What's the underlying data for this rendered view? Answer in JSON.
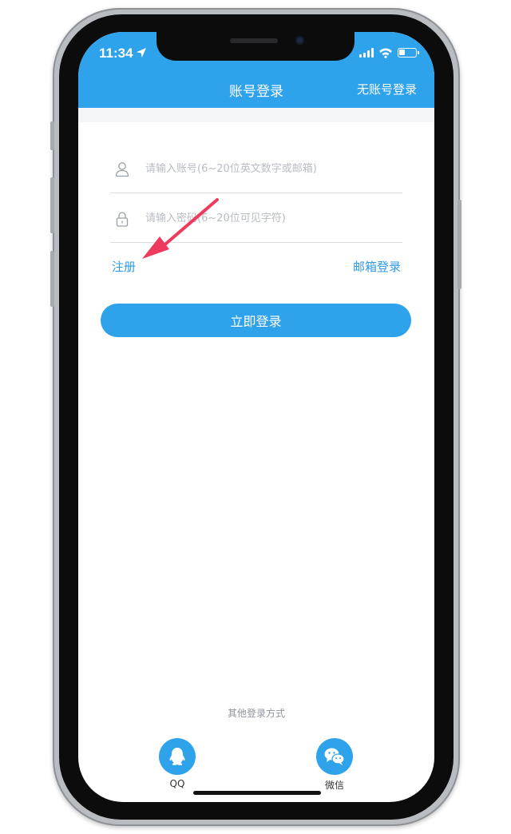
{
  "status_bar": {
    "time": "11:34",
    "battery_level": 0.35
  },
  "nav": {
    "title": "账号登录",
    "right_action": "无账号登录"
  },
  "form": {
    "account_placeholder": "请输入账号(6~20位英文数字或邮箱)",
    "password_placeholder": "请输入密码(6~20位可见字符)",
    "account_value": "",
    "password_value": ""
  },
  "links": {
    "register": "注册",
    "email_login": "邮箱登录"
  },
  "login_button": {
    "label": "立即登录"
  },
  "other_login": {
    "title": "其他登录方式",
    "qq_label": "QQ",
    "wechat_label": "微信"
  },
  "colors": {
    "accent": "#2fa2ec",
    "link": "#2f9be8",
    "annotation_arrow": "#ee3b5d"
  }
}
